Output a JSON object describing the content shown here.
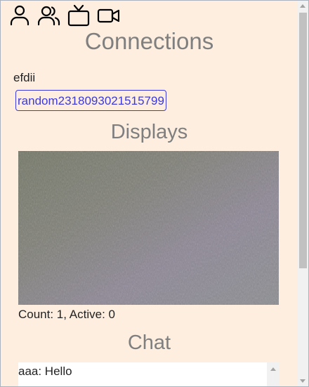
{
  "toolbar": {
    "icons": [
      "user-icon",
      "users-icon",
      "tv-icon",
      "video-camera-icon"
    ]
  },
  "connections": {
    "title": "Connections",
    "name": "efdii",
    "peer_button_label": "random2318093021515799"
  },
  "displays": {
    "title": "Displays",
    "count_text": "Count: 1, Active: 0"
  },
  "chat": {
    "title": "Chat",
    "messages": [
      {
        "text": "aaa: Hello"
      }
    ]
  },
  "colors": {
    "background": "#fdeee0",
    "title_gray": "#7f7f7f",
    "link_blue": "#3d3bd8"
  }
}
